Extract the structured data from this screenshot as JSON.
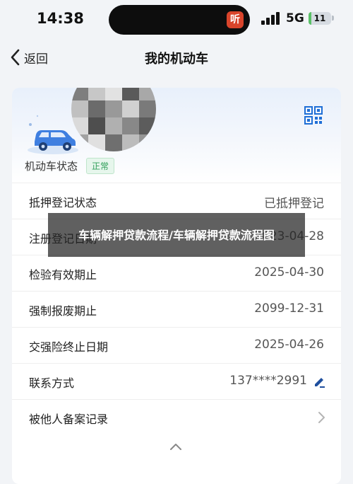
{
  "status_bar": {
    "time": "14:38",
    "app_badge": "听",
    "network": "5G",
    "battery": "11",
    "battery_level": 0.11
  },
  "nav": {
    "back_label": "返回",
    "title": "我的机动车"
  },
  "vehicle": {
    "status_label": "机动车状态",
    "status_badge": "正常",
    "status_color": "#2e9e58"
  },
  "details": [
    {
      "label": "抵押登记状态",
      "value": "已抵押登记"
    },
    {
      "label": "注册登记日期",
      "value": "2023-04-28"
    },
    {
      "label": "检验有效期止",
      "value": "2025-04-30"
    },
    {
      "label": "强制报废期止",
      "value": "2099-12-31"
    },
    {
      "label": "交强险终止日期",
      "value": "2025-04-26"
    },
    {
      "label": "联系方式",
      "value": "137****2991"
    },
    {
      "label": "被他人备案记录",
      "value": ""
    }
  ],
  "overlay": {
    "text": "车辆解押贷款流程/车辆解押贷款流程图"
  },
  "icons": {
    "back": "chevron-left-icon",
    "qr": "qr-code-icon",
    "edit": "edit-icon",
    "more": "chevron-right-icon",
    "collapse": "chevron-up-icon"
  },
  "colors": {
    "accent": "#1f6fd6",
    "badge_bg": "#e6f6ec",
    "overlay_bg": "#232323"
  }
}
